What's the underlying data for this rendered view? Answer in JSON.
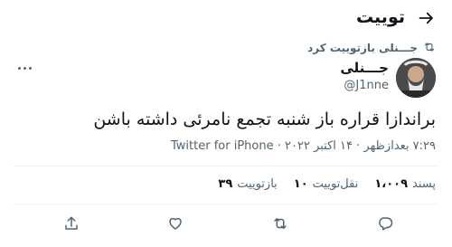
{
  "header": {
    "title": "توییت",
    "back_icon": "arrow-right-icon"
  },
  "retweet_context": {
    "text": "جـــنلی بازتوییت کرد",
    "icon": "retweet-icon"
  },
  "author": {
    "name": "جـــنلی",
    "handle": "@J1nne"
  },
  "tweet": {
    "text": "براندازا قراره باز شنبه تجمع نامرئی داشته باشن",
    "timestamp": "۷:۲۹ بعدازظهر · ۱۴ اکتبر ۲۰۲۲ · ",
    "source": "Twitter for iPhone"
  },
  "stats": {
    "retweets": {
      "count": "۳۹",
      "label": "بازتوییت"
    },
    "quotes": {
      "count": "۱۰",
      "label": "نقل‌توییت"
    },
    "likes": {
      "count": "۱،۰۰۹",
      "label": "پسند"
    }
  },
  "colors": {
    "text": "#0f1419",
    "secondary": "#536471",
    "divider": "#eff3f4"
  },
  "actions": [
    "reply-icon",
    "retweet-icon",
    "like-icon",
    "share-icon"
  ]
}
